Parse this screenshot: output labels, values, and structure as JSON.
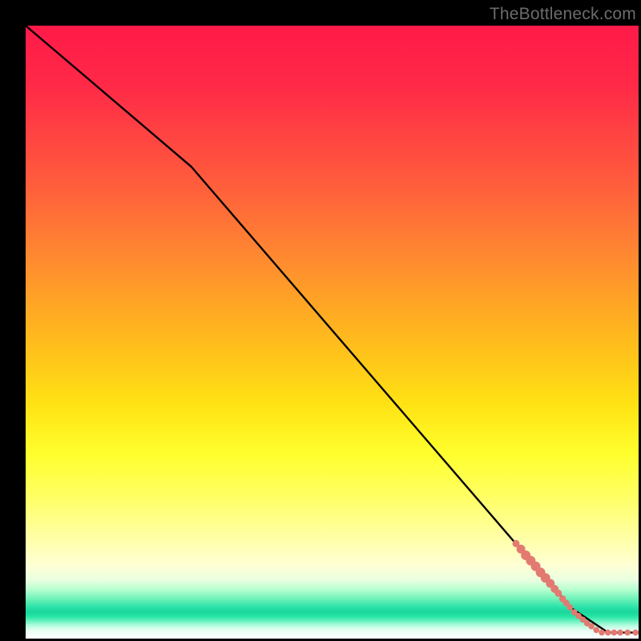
{
  "watermark": "TheBottleneck.com",
  "colors": {
    "line": "#000000",
    "marker_fill": "#e27a72",
    "marker_stroke": "#e27a72"
  },
  "chart_data": {
    "type": "line",
    "title": "",
    "xlabel": "",
    "ylabel": "",
    "xlim": [
      0,
      100
    ],
    "ylim": [
      0,
      100
    ],
    "grid": false,
    "legend": false,
    "series": [
      {
        "name": "curve",
        "style": "line",
        "x": [
          0,
          27,
          89,
          95,
          100
        ],
        "y": [
          100,
          77,
          5,
          1,
          1
        ]
      },
      {
        "name": "markers",
        "style": "scatter",
        "points": [
          {
            "x": 80.0,
            "y": 15.5,
            "r": 4.0
          },
          {
            "x": 80.8,
            "y": 14.6,
            "r": 5.0
          },
          {
            "x": 81.6,
            "y": 13.6,
            "r": 5.5
          },
          {
            "x": 82.4,
            "y": 12.7,
            "r": 5.5
          },
          {
            "x": 83.2,
            "y": 11.8,
            "r": 5.5
          },
          {
            "x": 84.0,
            "y": 10.8,
            "r": 5.5
          },
          {
            "x": 84.8,
            "y": 9.9,
            "r": 5.5
          },
          {
            "x": 85.6,
            "y": 9.0,
            "r": 5.0
          },
          {
            "x": 86.3,
            "y": 8.1,
            "r": 4.5
          },
          {
            "x": 86.9,
            "y": 7.4,
            "r": 4.0
          },
          {
            "x": 87.6,
            "y": 6.5,
            "r": 3.8
          },
          {
            "x": 88.2,
            "y": 5.8,
            "r": 3.6
          },
          {
            "x": 88.8,
            "y": 5.1,
            "r": 3.4
          },
          {
            "x": 89.5,
            "y": 4.3,
            "r": 3.4
          },
          {
            "x": 90.2,
            "y": 3.7,
            "r": 3.3
          },
          {
            "x": 90.9,
            "y": 3.1,
            "r": 3.3
          },
          {
            "x": 91.6,
            "y": 2.5,
            "r": 3.3
          },
          {
            "x": 92.3,
            "y": 2.0,
            "r": 3.3
          },
          {
            "x": 93.1,
            "y": 1.4,
            "r": 3.3
          },
          {
            "x": 94.0,
            "y": 1.0,
            "r": 3.3
          },
          {
            "x": 95.0,
            "y": 1.0,
            "r": 3.3
          },
          {
            "x": 96.0,
            "y": 1.0,
            "r": 3.3
          },
          {
            "x": 97.0,
            "y": 1.0,
            "r": 3.3
          },
          {
            "x": 98.2,
            "y": 1.0,
            "r": 3.3
          },
          {
            "x": 99.5,
            "y": 1.0,
            "r": 3.3
          }
        ]
      }
    ]
  }
}
